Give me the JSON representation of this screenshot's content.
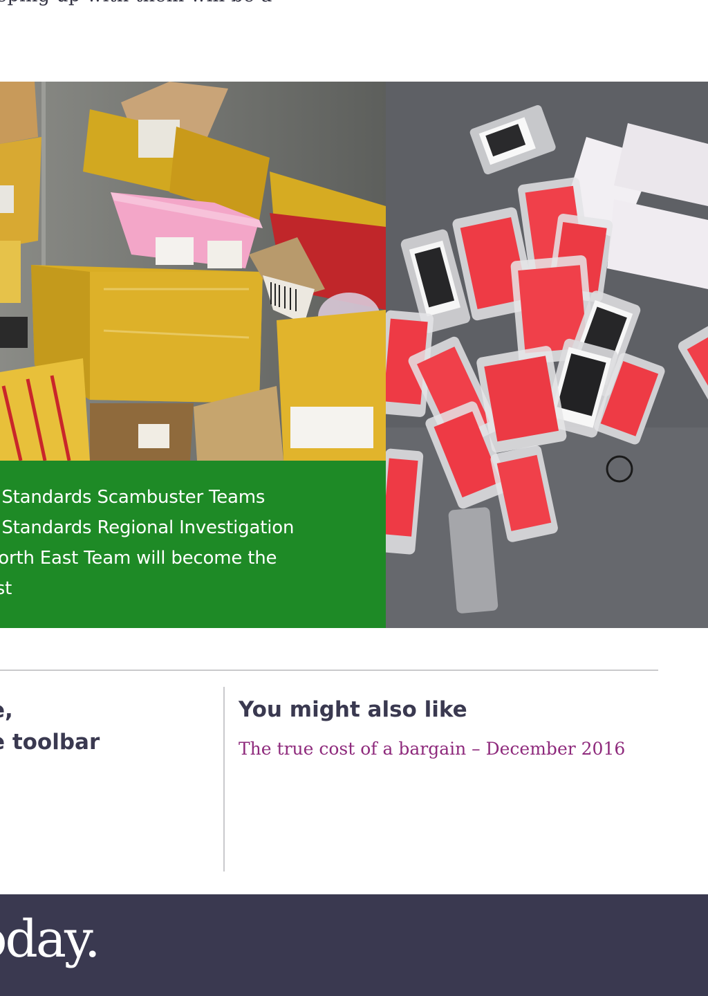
{
  "article": {
    "intro_fragment": "eeping up with them will be a"
  },
  "figure": {
    "caption_lines": [
      "g Standards Scambuster Teams",
      "g Standards Regional Investigation",
      " North East Team will become the",
      "ast"
    ]
  },
  "share": {
    "line1": "e,",
    "line2": "e toolbar"
  },
  "related": {
    "heading": "You might also like",
    "link_label": "The true cost of a bargain – December 2016"
  },
  "footer": {
    "logo_text": "oday."
  },
  "colors": {
    "caption_green": "#1e8a26",
    "footer_navy": "#3a3950",
    "link_purple": "#8e2a7c",
    "heading_navy": "#3a3950"
  }
}
